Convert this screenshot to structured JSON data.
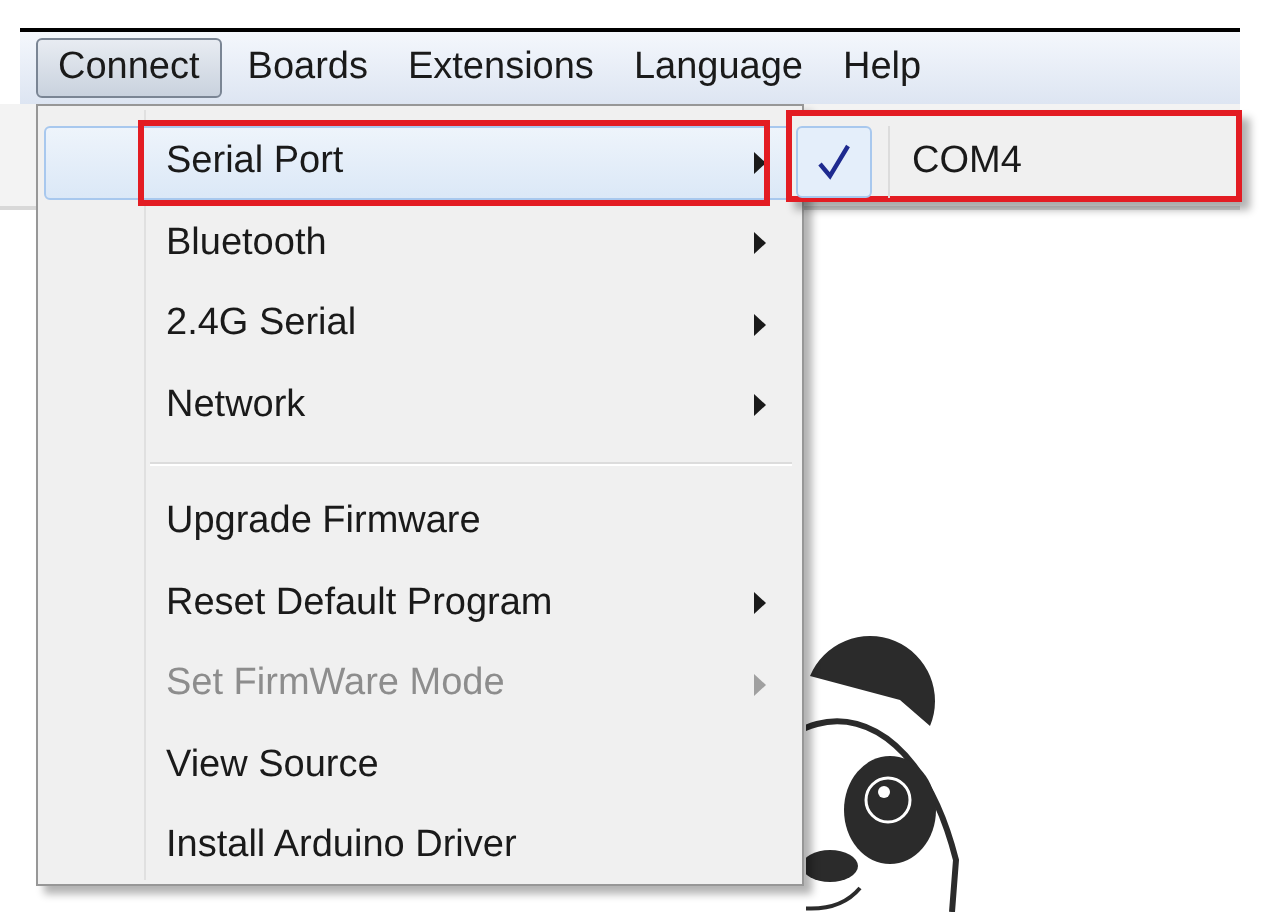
{
  "menu_bar": [
    {
      "label": "Connect",
      "selected": true
    },
    {
      "label": "Boards",
      "selected": false
    },
    {
      "label": "Extensions",
      "selected": false
    },
    {
      "label": "Language",
      "selected": false
    },
    {
      "label": "Help",
      "selected": false
    }
  ],
  "dropdown": [
    {
      "kind": "item",
      "label": "Serial Port",
      "submenu": true,
      "disabled": false,
      "selected": true,
      "annotated": true
    },
    {
      "kind": "item",
      "label": "Bluetooth",
      "submenu": true,
      "disabled": false,
      "selected": false,
      "annotated": false
    },
    {
      "kind": "item",
      "label": "2.4G Serial",
      "submenu": true,
      "disabled": false,
      "selected": false,
      "annotated": false
    },
    {
      "kind": "item",
      "label": "Network",
      "submenu": true,
      "disabled": false,
      "selected": false,
      "annotated": false
    },
    {
      "kind": "separator"
    },
    {
      "kind": "item",
      "label": "Upgrade Firmware",
      "submenu": false,
      "disabled": false,
      "selected": false,
      "annotated": false
    },
    {
      "kind": "item",
      "label": "Reset Default Program",
      "submenu": true,
      "disabled": false,
      "selected": false,
      "annotated": false
    },
    {
      "kind": "item",
      "label": "Set FirmWare Mode",
      "submenu": true,
      "disabled": true,
      "selected": false,
      "annotated": false
    },
    {
      "kind": "item",
      "label": "View Source",
      "submenu": false,
      "disabled": false,
      "selected": false,
      "annotated": false
    },
    {
      "kind": "item",
      "label": "Install Arduino Driver",
      "submenu": false,
      "disabled": false,
      "selected": false,
      "annotated": false
    }
  ],
  "submenu": {
    "annotated": true,
    "items": [
      {
        "label": "COM4",
        "checked": true
      }
    ]
  }
}
